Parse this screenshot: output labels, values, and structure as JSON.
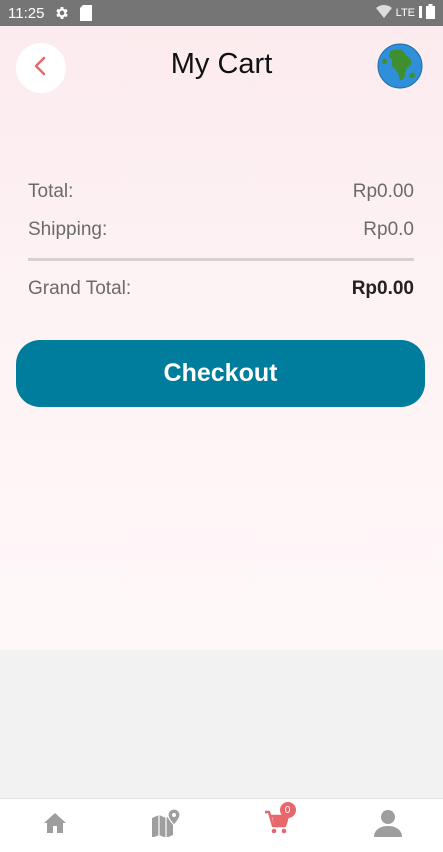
{
  "status_bar": {
    "time": "11:25",
    "network": "LTE"
  },
  "header": {
    "title": "My Cart"
  },
  "summary": {
    "total_label": "Total:",
    "total_value": "Rp0.00",
    "shipping_label": "Shipping:",
    "shipping_value": "Rp0.0",
    "grand_total_label": "Grand Total:",
    "grand_total_value": "Rp0.00"
  },
  "checkout": {
    "label": "Checkout"
  },
  "bottom_nav": {
    "items": [
      {
        "icon": "home-icon",
        "active": false
      },
      {
        "icon": "map-icon",
        "active": false
      },
      {
        "icon": "cart-icon",
        "active": true,
        "badge": "0"
      },
      {
        "icon": "profile-icon",
        "active": false
      }
    ]
  },
  "colors": {
    "accent": "#007d9c",
    "back_arrow": "#e8676a",
    "nav_inactive": "#9e9e9e",
    "nav_active": "#e8676a"
  }
}
